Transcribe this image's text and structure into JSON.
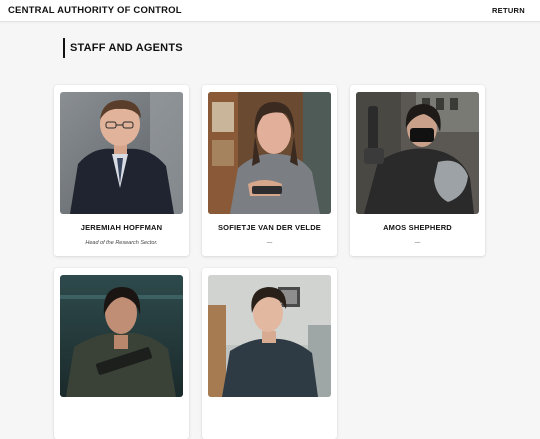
{
  "header": {
    "title": "CENTRAL AUTHORITY OF CONTROL",
    "return_label": "RETURN"
  },
  "section": {
    "title": "STAFF AND AGENTS"
  },
  "staff": [
    {
      "name": "JEREMIAH HOFFMAN",
      "role": "Head of the Research Sector."
    },
    {
      "name": "SOFIETJE VAN DER VELDE",
      "role": "—"
    },
    {
      "name": "AMOS SHEPHERD",
      "role": "—"
    },
    {
      "name": "",
      "role": ""
    },
    {
      "name": "",
      "role": ""
    }
  ],
  "colors": {
    "background": "#f6f6f6",
    "card": "#ffffff",
    "text": "#111111"
  }
}
